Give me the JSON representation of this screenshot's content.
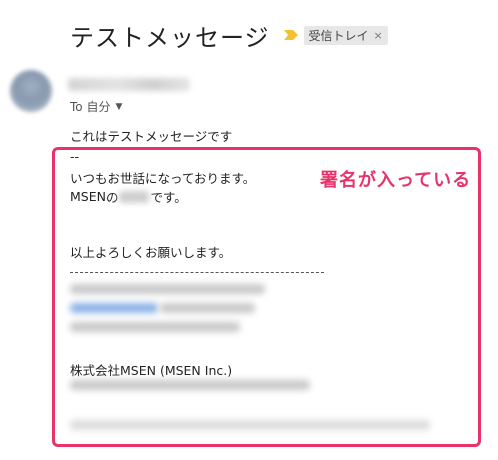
{
  "email": {
    "subject": "テストメッセージ",
    "label": "受信トレイ",
    "label_remove": "×",
    "to_prefix": "To 自分",
    "to_caret": "▼",
    "body": {
      "line1": "これはテストメッセージです",
      "line2": "--",
      "line3": "いつもお世話になっております。",
      "line4_prefix": "MSEN",
      "line4_middle": "の",
      "line4_suffix": "です。",
      "line5": "以上よろしくお願いします。",
      "company": "株式会社MSEN (MSEN Inc.)"
    }
  },
  "annotation": {
    "callout": "署名が入っている",
    "color": "#e83268"
  },
  "colors": {
    "important_marker": "#f2c232",
    "label_bg": "#e7e7e7"
  }
}
